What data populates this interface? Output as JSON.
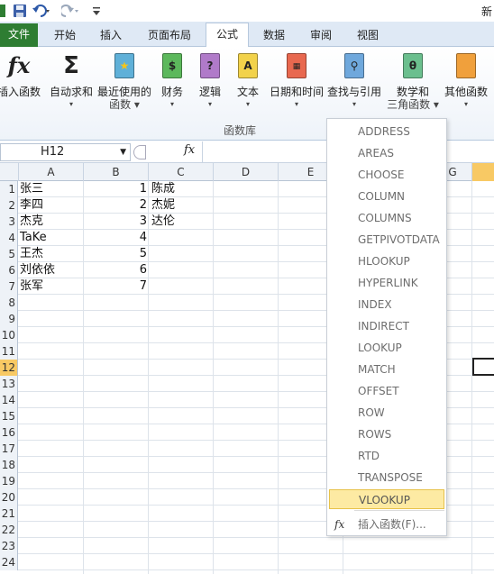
{
  "title_fragment": "新",
  "tabs": [
    {
      "label": "文件"
    },
    {
      "label": "开始"
    },
    {
      "label": "插入"
    },
    {
      "label": "页面布局"
    },
    {
      "label": "公式"
    },
    {
      "label": "数据"
    },
    {
      "label": "审阅"
    },
    {
      "label": "视图"
    }
  ],
  "ribbon": {
    "buttons": [
      {
        "line1": "插入函数",
        "line2": ""
      },
      {
        "line1": "自动求和",
        "line2": "▾"
      },
      {
        "line1": "最近使用的",
        "line2": "函数 ▾"
      },
      {
        "line1": "财务",
        "line2": "▾"
      },
      {
        "line1": "逻辑",
        "line2": "▾"
      },
      {
        "line1": "文本",
        "line2": "▾"
      },
      {
        "line1": "日期和时间",
        "line2": "▾"
      },
      {
        "line1": "查找与引用",
        "line2": "▾"
      },
      {
        "line1": "数学和",
        "line2": "三角函数 ▾"
      },
      {
        "line1": "其他函数",
        "line2": "▾"
      }
    ],
    "group_label": "函数库"
  },
  "formula_bar": {
    "name_box": "H12",
    "fx": "fx",
    "formula": ""
  },
  "grid": {
    "columns": [
      "A",
      "B",
      "C",
      "D",
      "E",
      "G"
    ],
    "rows": [
      {
        "num": "1",
        "A": "张三",
        "B": "1",
        "C": "陈成"
      },
      {
        "num": "2",
        "A": "李四",
        "B": "2",
        "C": "杰妮"
      },
      {
        "num": "3",
        "A": "杰克",
        "B": "3",
        "C": "达伦"
      },
      {
        "num": "4",
        "A": "TaKe",
        "B": "4",
        "C": ""
      },
      {
        "num": "5",
        "A": "王杰",
        "B": "5",
        "C": ""
      },
      {
        "num": "6",
        "A": "刘依依",
        "B": "6",
        "C": ""
      },
      {
        "num": "7",
        "A": "张军",
        "B": "7",
        "C": ""
      },
      {
        "num": "8",
        "A": "",
        "B": "",
        "C": ""
      },
      {
        "num": "9",
        "A": "",
        "B": "",
        "C": ""
      },
      {
        "num": "10",
        "A": "",
        "B": "",
        "C": ""
      },
      {
        "num": "11",
        "A": "",
        "B": "",
        "C": ""
      },
      {
        "num": "12",
        "A": "",
        "B": "",
        "C": ""
      },
      {
        "num": "13",
        "A": "",
        "B": "",
        "C": ""
      },
      {
        "num": "14",
        "A": "",
        "B": "",
        "C": ""
      },
      {
        "num": "15",
        "A": "",
        "B": "",
        "C": ""
      },
      {
        "num": "16",
        "A": "",
        "B": "",
        "C": ""
      },
      {
        "num": "17",
        "A": "",
        "B": "",
        "C": ""
      },
      {
        "num": "18",
        "A": "",
        "B": "",
        "C": ""
      },
      {
        "num": "19",
        "A": "",
        "B": "",
        "C": ""
      },
      {
        "num": "20",
        "A": "",
        "B": "",
        "C": ""
      },
      {
        "num": "21",
        "A": "",
        "B": "",
        "C": ""
      },
      {
        "num": "22",
        "A": "",
        "B": "",
        "C": ""
      },
      {
        "num": "23",
        "A": "",
        "B": "",
        "C": ""
      },
      {
        "num": "24",
        "A": "",
        "B": "",
        "C": ""
      }
    ]
  },
  "dropdown": {
    "items": [
      "ADDRESS",
      "AREAS",
      "CHOOSE",
      "COLUMN",
      "COLUMNS",
      "GETPIVOTDATA",
      "HLOOKUP",
      "HYPERLINK",
      "INDEX",
      "INDIRECT",
      "LOOKUP",
      "MATCH",
      "OFFSET",
      "ROW",
      "ROWS",
      "RTD",
      "TRANSPOSE",
      "VLOOKUP"
    ],
    "highlighted": "VLOOKUP",
    "insert_function": "插入函数(F)..."
  },
  "colors": {
    "file_tab": "#2e7d32",
    "highlight": "#fdeaa3",
    "selected_header": "#f8c964"
  }
}
